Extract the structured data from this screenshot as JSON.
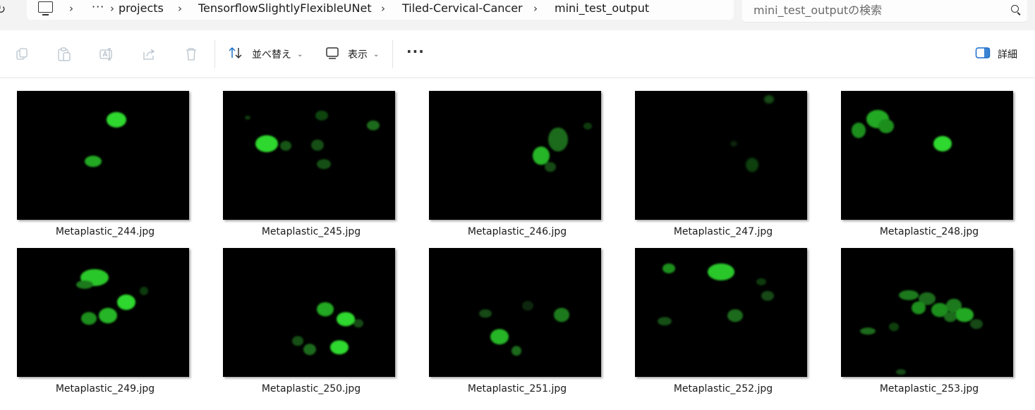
{
  "address_bar": {
    "refresh_icon": "refresh-icon",
    "breadcrumb": [
      "projects",
      "TensorflowSlightlyFlexibleUNet",
      "Tiled-Cervical-Cancer",
      "mini_test_output"
    ],
    "overflow": "···"
  },
  "search": {
    "placeholder": "mini_test_outputの検索"
  },
  "toolbar": {
    "sort_label": "並べ替え",
    "view_label": "表示",
    "details_label": "詳細"
  },
  "files": [
    {
      "name": "Metaplastic_244.jpg"
    },
    {
      "name": "Metaplastic_245.jpg"
    },
    {
      "name": "Metaplastic_246.jpg"
    },
    {
      "name": "Metaplastic_247.jpg"
    },
    {
      "name": "Metaplastic_248.jpg"
    },
    {
      "name": "Metaplastic_249.jpg"
    },
    {
      "name": "Metaplastic_250.jpg"
    },
    {
      "name": "Metaplastic_251.jpg"
    },
    {
      "name": "Metaplastic_252.jpg"
    },
    {
      "name": "Metaplastic_253.jpg"
    }
  ],
  "colors": {
    "cell_bright": "#34e634",
    "cell_dim": "#1d7a1d",
    "thumbnail_bg": "#000000"
  }
}
